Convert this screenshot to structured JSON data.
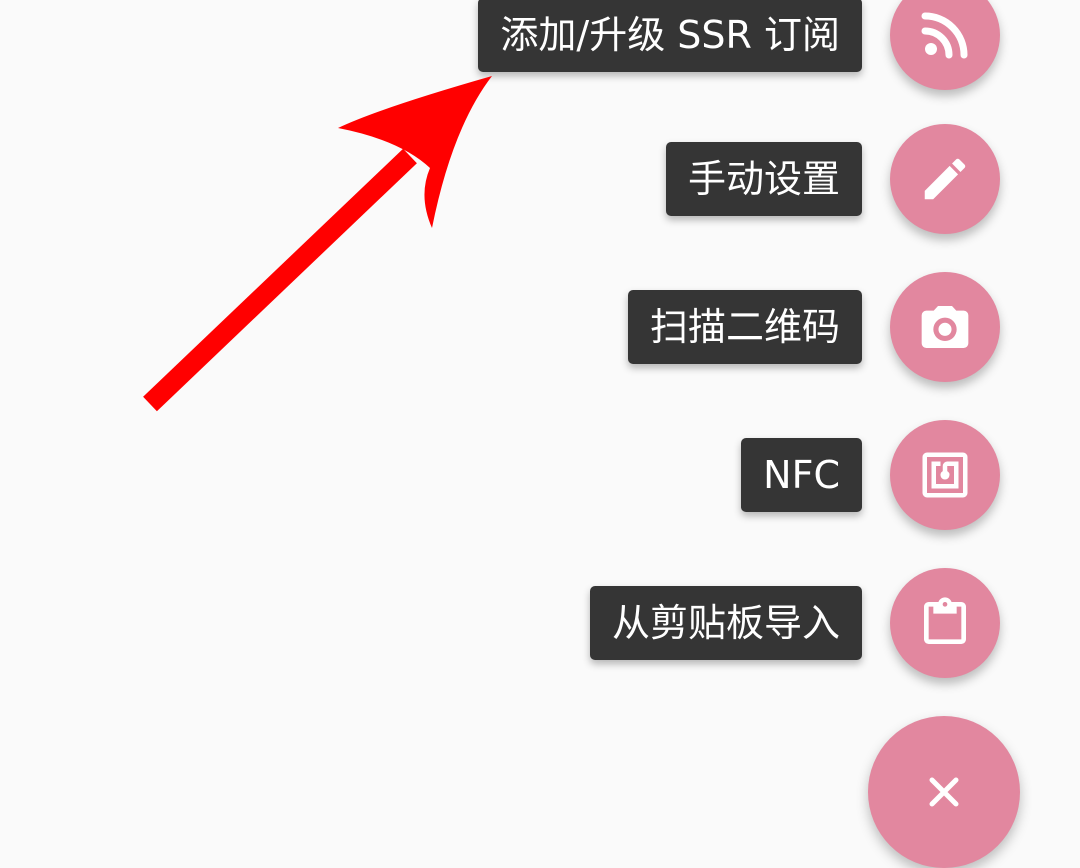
{
  "theme": {
    "accent": "#e2879f",
    "label_background": "#353535",
    "background": "#fafafa",
    "annotation_color": "#ff0000"
  },
  "menu": {
    "items": [
      {
        "label": "添加/升级 SSR 订阅",
        "icon": "rss-icon"
      },
      {
        "label": "手动设置",
        "icon": "pencil-icon"
      },
      {
        "label": "扫描二维码",
        "icon": "camera-icon"
      },
      {
        "label": "NFC",
        "icon": "nfc-icon"
      },
      {
        "label": "从剪贴板导入",
        "icon": "clipboard-icon"
      }
    ],
    "close_icon": "close-icon"
  },
  "annotation": {
    "icon": "red-arrow"
  }
}
